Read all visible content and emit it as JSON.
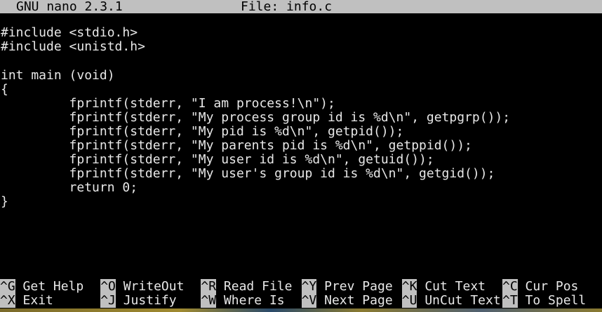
{
  "title": {
    "app": "GNU nano 2.3.1",
    "file": "File: info.c"
  },
  "code_lines": [
    "#include <stdio.h>",
    "#include <unistd.h>",
    "",
    "int main (void)",
    "{",
    "         fprintf(stderr, \"I am process!\\n\");",
    "         fprintf(stderr, \"My process group id is %d\\n\", getpgrp());",
    "         fprintf(stderr, \"My pid is %d\\n\", getpid());",
    "         fprintf(stderr, \"My parents pid is %d\\n\", getppid());",
    "         fprintf(stderr, \"My user id is %d\\n\", getuid());",
    "         fprintf(stderr, \"My user's group id is %d\\n\", getgid());",
    "         return 0;",
    "}"
  ],
  "shortcuts": [
    [
      {
        "key": "^G",
        "label": "Get Help"
      },
      {
        "key": "^O",
        "label": "WriteOut"
      },
      {
        "key": "^R",
        "label": "Read File"
      },
      {
        "key": "^Y",
        "label": "Prev Page"
      },
      {
        "key": "^K",
        "label": "Cut Text"
      },
      {
        "key": "^C",
        "label": "Cur Pos"
      }
    ],
    [
      {
        "key": "^X",
        "label": "Exit"
      },
      {
        "key": "^J",
        "label": "Justify"
      },
      {
        "key": "^W",
        "label": "Where Is"
      },
      {
        "key": "^V",
        "label": "Next Page"
      },
      {
        "key": "^U",
        "label": "UnCut Text"
      },
      {
        "key": "^T",
        "label": "To Spell"
      }
    ]
  ]
}
